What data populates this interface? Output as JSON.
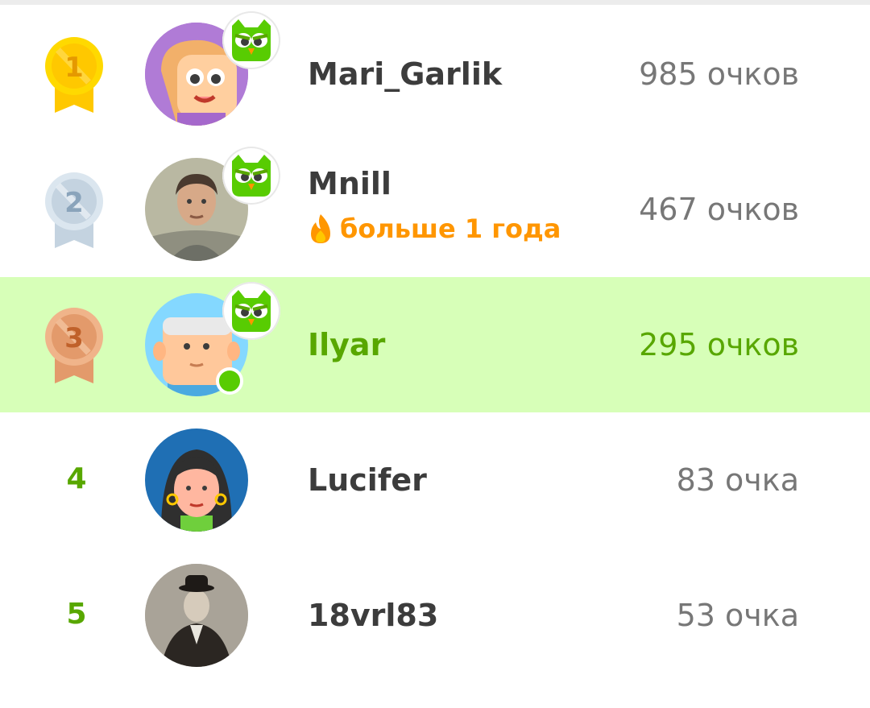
{
  "leaderboard": {
    "rows": [
      {
        "rank": "1",
        "name": "Mari_Garlik",
        "points": "985 очков",
        "medal": "gold",
        "medal_color": "#ffc800"
      },
      {
        "rank": "2",
        "name": "Mnill",
        "streak": "больше 1 года",
        "points": "467 очков",
        "medal": "silver",
        "medal_color": "#c4d3e0"
      },
      {
        "rank": "3",
        "name": "Ilyar",
        "points": "295 очков",
        "medal": "bronze",
        "medal_color": "#e39a6b",
        "current_user": true
      },
      {
        "rank": "4",
        "name": "Lucifer",
        "points": "83 очка"
      },
      {
        "rank": "5",
        "name": "18vrl83",
        "points": "53 очка"
      }
    ]
  },
  "colors": {
    "highlight_bg": "#d7ffb8",
    "highlight_text": "#58a700",
    "streak": "#ff9600",
    "text": "#3c3c3c",
    "muted": "#777777"
  },
  "icons": {
    "owl_badge": "duolingo-owl-icon",
    "streak": "flame-icon",
    "online": "online-dot"
  }
}
